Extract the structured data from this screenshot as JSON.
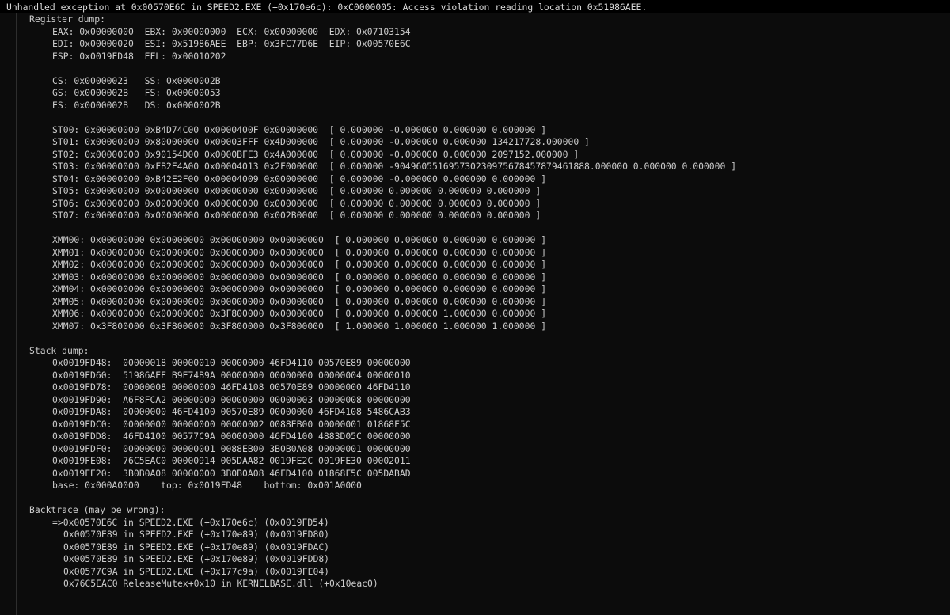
{
  "exception": "Unhandled exception at 0x00570E6C in SPEED2.EXE (+0x170e6c): 0xC0000005: Access violation reading location 0x51986AEE.",
  "register_header": "Register dump:",
  "regs": {
    "r1": "EAX: 0x00000000  EBX: 0x00000000  ECX: 0x00000000  EDX: 0x07103154",
    "r2": "EDI: 0x00000020  ESI: 0x51986AEE  EBP: 0x3FC77D6E  EIP: 0x00570E6C",
    "r3": "ESP: 0x0019FD48  EFL: 0x00010202"
  },
  "segs": {
    "s1": "CS: 0x00000023   SS: 0x0000002B",
    "s2": "GS: 0x0000002B   FS: 0x00000053",
    "s3": "ES: 0x0000002B   DS: 0x0000002B"
  },
  "st": [
    "ST00: 0x00000000 0xB4D74C00 0x0000400F 0x00000000  [ 0.000000 -0.000000 0.000000 0.000000 ]",
    "ST01: 0x00000000 0x80000000 0x00003FFF 0x4D000000  [ 0.000000 -0.000000 0.000000 134217728.000000 ]",
    "ST02: 0x00000000 0x90154D00 0x0000BFE3 0x4A000000  [ 0.000000 -0.000000 0.000000 2097152.000000 ]",
    "ST03: 0x00000000 0xFB2E4A00 0x00004013 0x2F000000  [ 0.000000 -904960551695730230975678457879461888.000000 0.000000 0.000000 ]",
    "ST04: 0x00000000 0xB42E2F00 0x00004009 0x00000000  [ 0.000000 -0.000000 0.000000 0.000000 ]",
    "ST05: 0x00000000 0x00000000 0x00000000 0x00000000  [ 0.000000 0.000000 0.000000 0.000000 ]",
    "ST06: 0x00000000 0x00000000 0x00000000 0x00000000  [ 0.000000 0.000000 0.000000 0.000000 ]",
    "ST07: 0x00000000 0x00000000 0x00000000 0x002B0000  [ 0.000000 0.000000 0.000000 0.000000 ]"
  ],
  "xmm": [
    "XMM00: 0x00000000 0x00000000 0x00000000 0x00000000  [ 0.000000 0.000000 0.000000 0.000000 ]",
    "XMM01: 0x00000000 0x00000000 0x00000000 0x00000000  [ 0.000000 0.000000 0.000000 0.000000 ]",
    "XMM02: 0x00000000 0x00000000 0x00000000 0x00000000  [ 0.000000 0.000000 0.000000 0.000000 ]",
    "XMM03: 0x00000000 0x00000000 0x00000000 0x00000000  [ 0.000000 0.000000 0.000000 0.000000 ]",
    "XMM04: 0x00000000 0x00000000 0x00000000 0x00000000  [ 0.000000 0.000000 0.000000 0.000000 ]",
    "XMM05: 0x00000000 0x00000000 0x00000000 0x00000000  [ 0.000000 0.000000 0.000000 0.000000 ]",
    "XMM06: 0x00000000 0x00000000 0x3F800000 0x00000000  [ 0.000000 0.000000 1.000000 0.000000 ]",
    "XMM07: 0x3F800000 0x3F800000 0x3F800000 0x3F800000  [ 1.000000 1.000000 1.000000 1.000000 ]"
  ],
  "stack_header": "Stack dump:",
  "stack": [
    "0x0019FD48:  00000018 00000010 00000000 46FD4110 00570E89 00000000",
    "0x0019FD60:  51986AEE B9E74B9A 00000000 00000000 00000004 00000010",
    "0x0019FD78:  00000008 00000000 46FD4108 00570E89 00000000 46FD4110",
    "0x0019FD90:  A6F8FCA2 00000000 00000000 00000003 00000008 00000000",
    "0x0019FDA8:  00000000 46FD4100 00570E89 00000000 46FD4108 5486CAB3",
    "0x0019FDC0:  00000000 00000000 00000002 0088EB00 00000001 01868F5C",
    "0x0019FDD8:  46FD4100 00577C9A 00000000 46FD4100 4883D05C 00000000",
    "0x0019FDF0:  00000000 00000001 0088EB00 3B0B0A08 00000001 00000000",
    "0x0019FE08:  76C5EAC0 00000914 005DAA82 0019FE2C 0019FE30 00002011",
    "0x0019FE20:  3B0B0A08 00000000 3B0B0A08 46FD4100 01868F5C 005DABAD"
  ],
  "stack_base": "base: 0x000A0000    top: 0x0019FD48    bottom: 0x001A0000",
  "backtrace_header": "Backtrace (may be wrong):",
  "backtrace_first": "=>0x00570E6C in SPEED2.EXE (+0x170e6c) (0x0019FD54)",
  "backtrace": [
    "0x00570E89 in SPEED2.EXE (+0x170e89) (0x0019FD80)",
    "0x00570E89 in SPEED2.EXE (+0x170e89) (0x0019FDAC)",
    "0x00570E89 in SPEED2.EXE (+0x170e89) (0x0019FDD8)",
    "0x00577C9A in SPEED2.EXE (+0x177c9a) (0x0019FE04)",
    "0x76C5EAC0 ReleaseMutex+0x10 in KERNELBASE.dll (+0x10eac0)"
  ]
}
